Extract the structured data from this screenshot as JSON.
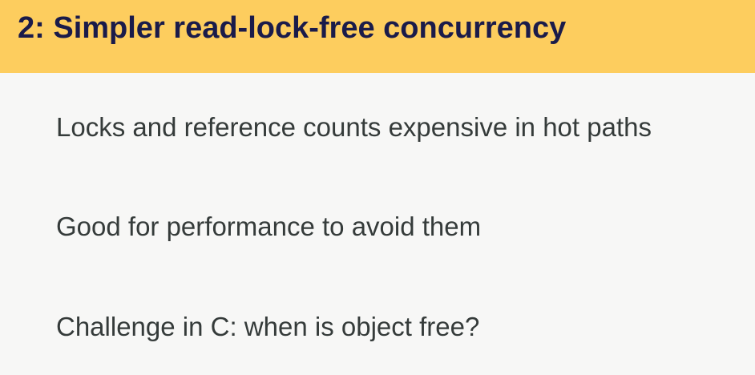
{
  "slide": {
    "title": "2: Simpler read-lock-free concurrency",
    "bullets": [
      "Locks and reference counts expensive in hot paths",
      "Good for performance to avoid them",
      "Challenge in C: when is object free?"
    ]
  },
  "colors": {
    "title_bar": "#fdcd5e",
    "title_text": "#1a1b4a",
    "body_text": "#353b3a",
    "background": "#f7f7f6"
  }
}
